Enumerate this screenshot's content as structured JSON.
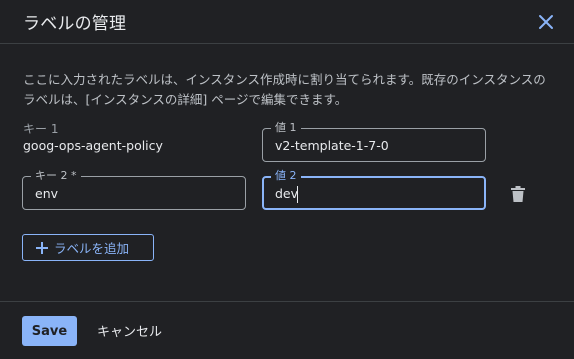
{
  "dialog": {
    "title": "ラベルの管理",
    "description": "ここに入力されたラベルは、インスタンス作成時に割り当てられます。既存のインスタンスのラベルは、[インスタンスの詳細] ページで編集できます。"
  },
  "labels": [
    {
      "key_label": "キー 1",
      "key_value": "goog-ops-agent-policy",
      "value_label": "値 1",
      "value_value": "v2-template-1-7-0"
    },
    {
      "key_label": "キー 2 *",
      "key_value": "env",
      "value_label": "値 2",
      "value_value": "dev"
    }
  ],
  "add_label_button": "ラベルを追加",
  "footer": {
    "save": "Save",
    "cancel": "キャンセル"
  },
  "colors": {
    "background": "#202124",
    "accent": "#8ab4f8",
    "text": "#e8eaed",
    "divider": "#3c4043"
  },
  "icons": {
    "close": "close-icon",
    "delete": "trash-icon",
    "add": "plus-icon"
  }
}
